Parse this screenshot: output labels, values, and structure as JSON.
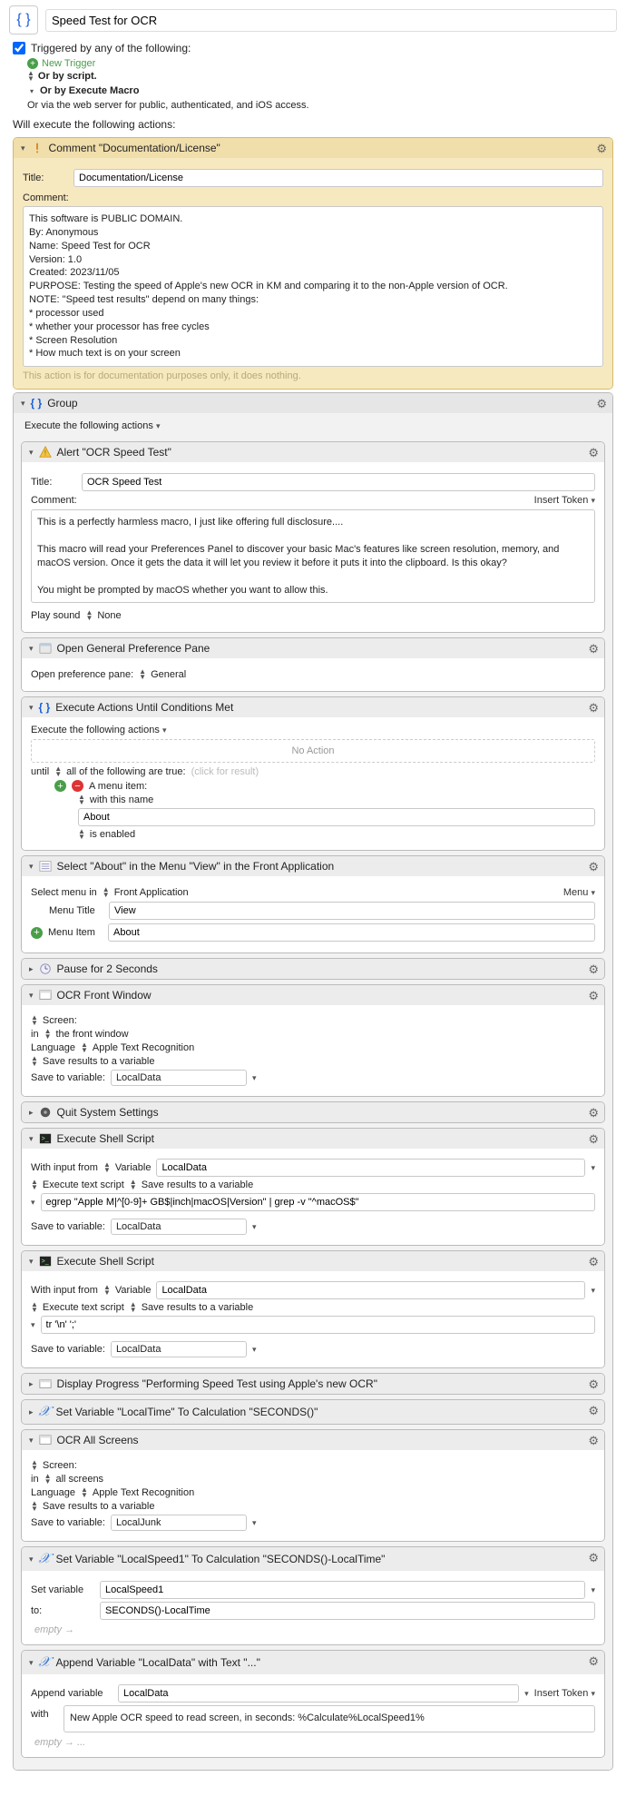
{
  "header": {
    "macro_name": "Speed Test for OCR",
    "triggered_label": "Triggered by any of the following:",
    "new_trigger": "New Trigger",
    "or_script": "Or by script.",
    "or_execute": "Or by Execute Macro",
    "or_web": "Or via the web server for public, authenticated, and iOS access.",
    "will_execute": "Will execute the following actions:"
  },
  "comment_action": {
    "title": "Comment \"Documentation/License\"",
    "title_label": "Title:",
    "title_value": "Documentation/License",
    "comment_label": "Comment:",
    "comment_body": "This software is PUBLIC DOMAIN.\nBy: Anonymous\nName: Speed Test for OCR\nVersion: 1.0\nCreated: 2023/11/05\nPURPOSE: Testing the speed of Apple's new OCR in KM and comparing it to the non-Apple version of OCR.\nNOTE: \"Speed test results\" depend on many things:\n* processor used\n* whether your processor has free cycles\n* Screen Resolution\n* How much text is on your screen",
    "footer_note": "This action is for documentation purposes only, it does nothing."
  },
  "group": {
    "title": "Group",
    "subtitle": "Execute the following actions"
  },
  "alert": {
    "header": "Alert \"OCR Speed Test\"",
    "title_label": "Title:",
    "title_value": "OCR Speed Test",
    "comment_label": "Comment:",
    "insert_token": "Insert Token",
    "body": "This is a perfectly harmless macro, I just like offering full disclosure....\n\nThis macro will read your Preferences Panel to discover your basic Mac's features like screen resolution, memory, and macOS version. Once it gets the data it will let you review it before it puts it into the clipboard. Is this okay?\n\nYou might be prompted by macOS whether you want to allow this.",
    "play_sound_label": "Play sound",
    "play_sound_value": "None"
  },
  "open_pref": {
    "header": "Open General Preference Pane",
    "label": "Open preference pane:",
    "value": "General"
  },
  "exec_until": {
    "header": "Execute Actions Until Conditions Met",
    "subtitle": "Execute the following actions",
    "no_action": "No Action",
    "until": "until",
    "all_true": "all of the following are true:",
    "click_result": "(click for result)",
    "menu_item": "A menu item:",
    "with_name": "with this name",
    "about": "About",
    "enabled": "is enabled"
  },
  "select_menu": {
    "header": "Select \"About\" in the Menu \"View\" in the Front Application",
    "select_in_label": "Select menu in",
    "select_in_value": "Front Application",
    "menu_dropdown": "Menu",
    "menu_title_label": "Menu Title",
    "menu_title_value": "View",
    "menu_item_label": "Menu Item",
    "menu_item_value": "About"
  },
  "pause": {
    "header": "Pause for 2 Seconds"
  },
  "ocr_front": {
    "header": "OCR Front Window",
    "screen": "Screen:",
    "in": "in",
    "front_window": "the front window",
    "language_label": "Language",
    "language_value": "Apple Text Recognition",
    "save_label": "Save results to a variable",
    "save_to": "Save to variable:",
    "var": "LocalData"
  },
  "quit": {
    "header": "Quit System Settings"
  },
  "shell1": {
    "header": "Execute Shell Script",
    "with_input": "With input from",
    "variable": "Variable",
    "var": "LocalData",
    "exec_text": "Execute text script",
    "save_results": "Save results to a variable",
    "script": "egrep \"Apple M|^[0-9]+ GB$|inch|macOS|Version\" | grep -v \"^macOS$\"",
    "save_to": "Save to variable:",
    "save_var": "LocalData"
  },
  "shell2": {
    "header": "Execute Shell Script",
    "with_input": "With input from",
    "variable": "Variable",
    "var": "LocalData",
    "exec_text": "Execute text script",
    "save_results": "Save results to a variable",
    "script": "tr '\\n' ';'",
    "save_to": "Save to variable:",
    "save_var": "LocalData"
  },
  "progress": {
    "header": "Display Progress \"Performing Speed Test using Apple's new OCR\""
  },
  "setvar_time": {
    "header": "Set Variable \"LocalTime\" To Calculation \"SECONDS()\""
  },
  "ocr_all": {
    "header": "OCR All Screens",
    "screen": "Screen:",
    "in": "in",
    "all_screens": "all screens",
    "language_label": "Language",
    "language_value": "Apple Text Recognition",
    "save_label": "Save results to a variable",
    "save_to": "Save to variable:",
    "var": "LocalJunk"
  },
  "setvar_speed": {
    "header": "Set Variable \"LocalSpeed1\" To Calculation \"SECONDS()-LocalTime\"",
    "set_label": "Set variable",
    "set_var": "LocalSpeed1",
    "to_label": "to:",
    "to_value": "SECONDS()-LocalTime",
    "empty": "empty →"
  },
  "append": {
    "header": "Append Variable \"LocalData\" with Text \"...\"",
    "append_label": "Append variable",
    "append_var": "LocalData",
    "insert_token": "Insert Token",
    "with_label": "with",
    "with_text": "New Apple OCR speed to read screen, in seconds: %Calculate%LocalSpeed1%",
    "empty": "empty → ..."
  }
}
